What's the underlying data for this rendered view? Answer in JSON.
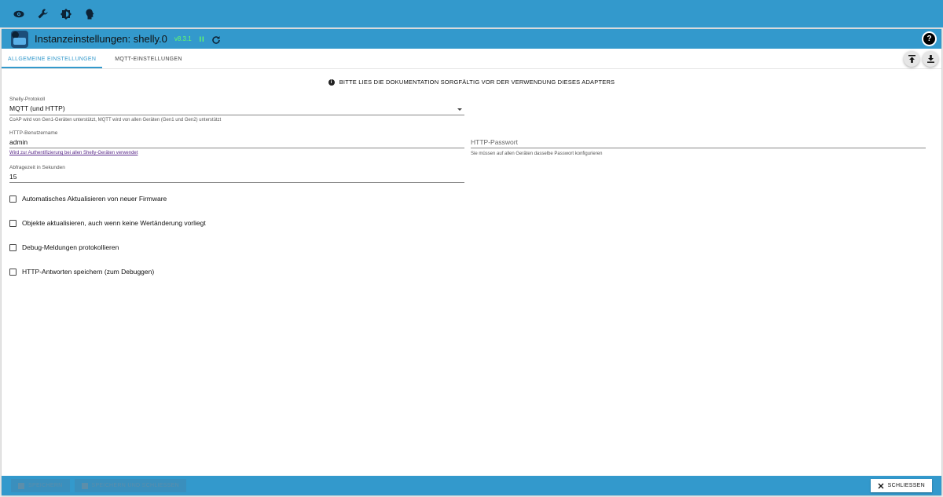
{
  "header": {
    "title": "Instanzeinstellungen: shelly.0",
    "version": "v8.3.1",
    "pause_glyph": "II",
    "help_glyph": "?"
  },
  "tabs": [
    "ALLGEMEINE EINSTELLUNGEN",
    "MQTT-EINSTELLUNGEN"
  ],
  "notice": "BITTE LIES DIE DOKUMENTATION SORGFÄLTIG VOR DER VERWENDUNG DIESES ADAPTERS",
  "protocol": {
    "label": "Shelly-Protokoll",
    "value": "MQTT (und HTTP)",
    "help": "CoAP wird von Gen1-Geräten unterstützt, MQTT wird von allen Geräten (Gen1 und Gen2) unterstützt"
  },
  "username": {
    "label": "HTTP-Benutzername",
    "value": "admin",
    "help": "Wird zur Authentifizierung bei allen Shelly-Geräten verwendet"
  },
  "password": {
    "placeholder": "HTTP-Passwort",
    "help": "Sie müssen auf allen Geräten dasselbe Passwort konfigurieren"
  },
  "polling": {
    "label": "Abfragezeit in Sekunden",
    "value": "15"
  },
  "checkboxes": [
    "Automatisches Aktualisieren von neuer Firmware",
    "Objekte aktualisieren, auch wenn keine Wertänderung vorliegt",
    "Debug-Meldungen protokollieren",
    "HTTP-Antworten speichern (zum Debuggen)"
  ],
  "footer": {
    "save": "SPEICHERN",
    "save_close": "SPEICHERN UND SCHLIESSEN",
    "close": "SCHLIESSEN"
  },
  "colors": {
    "accent": "#3399cc",
    "version": "#66ff66"
  }
}
